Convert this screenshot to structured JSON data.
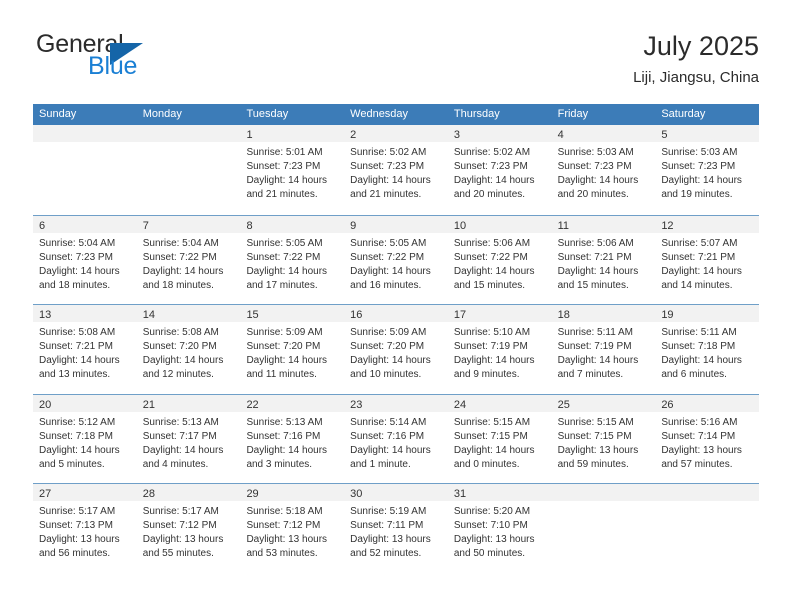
{
  "brand": {
    "name_top": "General",
    "name_bottom": "Blue",
    "accent_color": "#1a7fd4",
    "flag_color": "#1565a8"
  },
  "header": {
    "title": "July 2025",
    "location": "Liji, Jiangsu, China"
  },
  "calendar": {
    "header_bg": "#3c7cb8",
    "day_band_bg": "#f2f2f2",
    "weekdays": [
      "Sunday",
      "Monday",
      "Tuesday",
      "Wednesday",
      "Thursday",
      "Friday",
      "Saturday"
    ],
    "weeks": [
      [
        {
          "empty": true
        },
        {
          "empty": true
        },
        {
          "day": "1",
          "sunrise": "Sunrise: 5:01 AM",
          "sunset": "Sunset: 7:23 PM",
          "daylight": "Daylight: 14 hours and 21 minutes."
        },
        {
          "day": "2",
          "sunrise": "Sunrise: 5:02 AM",
          "sunset": "Sunset: 7:23 PM",
          "daylight": "Daylight: 14 hours and 21 minutes."
        },
        {
          "day": "3",
          "sunrise": "Sunrise: 5:02 AM",
          "sunset": "Sunset: 7:23 PM",
          "daylight": "Daylight: 14 hours and 20 minutes."
        },
        {
          "day": "4",
          "sunrise": "Sunrise: 5:03 AM",
          "sunset": "Sunset: 7:23 PM",
          "daylight": "Daylight: 14 hours and 20 minutes."
        },
        {
          "day": "5",
          "sunrise": "Sunrise: 5:03 AM",
          "sunset": "Sunset: 7:23 PM",
          "daylight": "Daylight: 14 hours and 19 minutes."
        }
      ],
      [
        {
          "day": "6",
          "sunrise": "Sunrise: 5:04 AM",
          "sunset": "Sunset: 7:23 PM",
          "daylight": "Daylight: 14 hours and 18 minutes."
        },
        {
          "day": "7",
          "sunrise": "Sunrise: 5:04 AM",
          "sunset": "Sunset: 7:22 PM",
          "daylight": "Daylight: 14 hours and 18 minutes."
        },
        {
          "day": "8",
          "sunrise": "Sunrise: 5:05 AM",
          "sunset": "Sunset: 7:22 PM",
          "daylight": "Daylight: 14 hours and 17 minutes."
        },
        {
          "day": "9",
          "sunrise": "Sunrise: 5:05 AM",
          "sunset": "Sunset: 7:22 PM",
          "daylight": "Daylight: 14 hours and 16 minutes."
        },
        {
          "day": "10",
          "sunrise": "Sunrise: 5:06 AM",
          "sunset": "Sunset: 7:22 PM",
          "daylight": "Daylight: 14 hours and 15 minutes."
        },
        {
          "day": "11",
          "sunrise": "Sunrise: 5:06 AM",
          "sunset": "Sunset: 7:21 PM",
          "daylight": "Daylight: 14 hours and 15 minutes."
        },
        {
          "day": "12",
          "sunrise": "Sunrise: 5:07 AM",
          "sunset": "Sunset: 7:21 PM",
          "daylight": "Daylight: 14 hours and 14 minutes."
        }
      ],
      [
        {
          "day": "13",
          "sunrise": "Sunrise: 5:08 AM",
          "sunset": "Sunset: 7:21 PM",
          "daylight": "Daylight: 14 hours and 13 minutes."
        },
        {
          "day": "14",
          "sunrise": "Sunrise: 5:08 AM",
          "sunset": "Sunset: 7:20 PM",
          "daylight": "Daylight: 14 hours and 12 minutes."
        },
        {
          "day": "15",
          "sunrise": "Sunrise: 5:09 AM",
          "sunset": "Sunset: 7:20 PM",
          "daylight": "Daylight: 14 hours and 11 minutes."
        },
        {
          "day": "16",
          "sunrise": "Sunrise: 5:09 AM",
          "sunset": "Sunset: 7:20 PM",
          "daylight": "Daylight: 14 hours and 10 minutes."
        },
        {
          "day": "17",
          "sunrise": "Sunrise: 5:10 AM",
          "sunset": "Sunset: 7:19 PM",
          "daylight": "Daylight: 14 hours and 9 minutes."
        },
        {
          "day": "18",
          "sunrise": "Sunrise: 5:11 AM",
          "sunset": "Sunset: 7:19 PM",
          "daylight": "Daylight: 14 hours and 7 minutes."
        },
        {
          "day": "19",
          "sunrise": "Sunrise: 5:11 AM",
          "sunset": "Sunset: 7:18 PM",
          "daylight": "Daylight: 14 hours and 6 minutes."
        }
      ],
      [
        {
          "day": "20",
          "sunrise": "Sunrise: 5:12 AM",
          "sunset": "Sunset: 7:18 PM",
          "daylight": "Daylight: 14 hours and 5 minutes."
        },
        {
          "day": "21",
          "sunrise": "Sunrise: 5:13 AM",
          "sunset": "Sunset: 7:17 PM",
          "daylight": "Daylight: 14 hours and 4 minutes."
        },
        {
          "day": "22",
          "sunrise": "Sunrise: 5:13 AM",
          "sunset": "Sunset: 7:16 PM",
          "daylight": "Daylight: 14 hours and 3 minutes."
        },
        {
          "day": "23",
          "sunrise": "Sunrise: 5:14 AM",
          "sunset": "Sunset: 7:16 PM",
          "daylight": "Daylight: 14 hours and 1 minute."
        },
        {
          "day": "24",
          "sunrise": "Sunrise: 5:15 AM",
          "sunset": "Sunset: 7:15 PM",
          "daylight": "Daylight: 14 hours and 0 minutes."
        },
        {
          "day": "25",
          "sunrise": "Sunrise: 5:15 AM",
          "sunset": "Sunset: 7:15 PM",
          "daylight": "Daylight: 13 hours and 59 minutes."
        },
        {
          "day": "26",
          "sunrise": "Sunrise: 5:16 AM",
          "sunset": "Sunset: 7:14 PM",
          "daylight": "Daylight: 13 hours and 57 minutes."
        }
      ],
      [
        {
          "day": "27",
          "sunrise": "Sunrise: 5:17 AM",
          "sunset": "Sunset: 7:13 PM",
          "daylight": "Daylight: 13 hours and 56 minutes."
        },
        {
          "day": "28",
          "sunrise": "Sunrise: 5:17 AM",
          "sunset": "Sunset: 7:12 PM",
          "daylight": "Daylight: 13 hours and 55 minutes."
        },
        {
          "day": "29",
          "sunrise": "Sunrise: 5:18 AM",
          "sunset": "Sunset: 7:12 PM",
          "daylight": "Daylight: 13 hours and 53 minutes."
        },
        {
          "day": "30",
          "sunrise": "Sunrise: 5:19 AM",
          "sunset": "Sunset: 7:11 PM",
          "daylight": "Daylight: 13 hours and 52 minutes."
        },
        {
          "day": "31",
          "sunrise": "Sunrise: 5:20 AM",
          "sunset": "Sunset: 7:10 PM",
          "daylight": "Daylight: 13 hours and 50 minutes."
        },
        {
          "empty": true
        },
        {
          "empty": true
        }
      ]
    ]
  }
}
